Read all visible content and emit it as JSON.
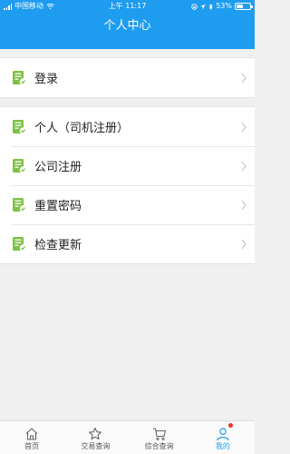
{
  "status_bar": {
    "carrier": "中国移动",
    "time": "上午 11:17",
    "battery": "53%",
    "battery_level": 0.53
  },
  "header": {
    "title": "个人中心"
  },
  "menu": {
    "login": {
      "label": "登录"
    },
    "items": [
      {
        "label": "个人（司机注册）"
      },
      {
        "label": "公司注册"
      },
      {
        "label": "重置密码"
      },
      {
        "label": "检查更新"
      }
    ]
  },
  "tabbar": {
    "tabs": [
      {
        "label": "首页",
        "icon": "home-icon"
      },
      {
        "label": "交易查询",
        "icon": "star-icon"
      },
      {
        "label": "综合查询",
        "icon": "cart-icon"
      },
      {
        "label": "我的",
        "icon": "person-icon"
      }
    ]
  },
  "colors": {
    "accent": "#1e9cf0",
    "icon_green": "#7cc242",
    "badge_red": "#f0332a"
  }
}
